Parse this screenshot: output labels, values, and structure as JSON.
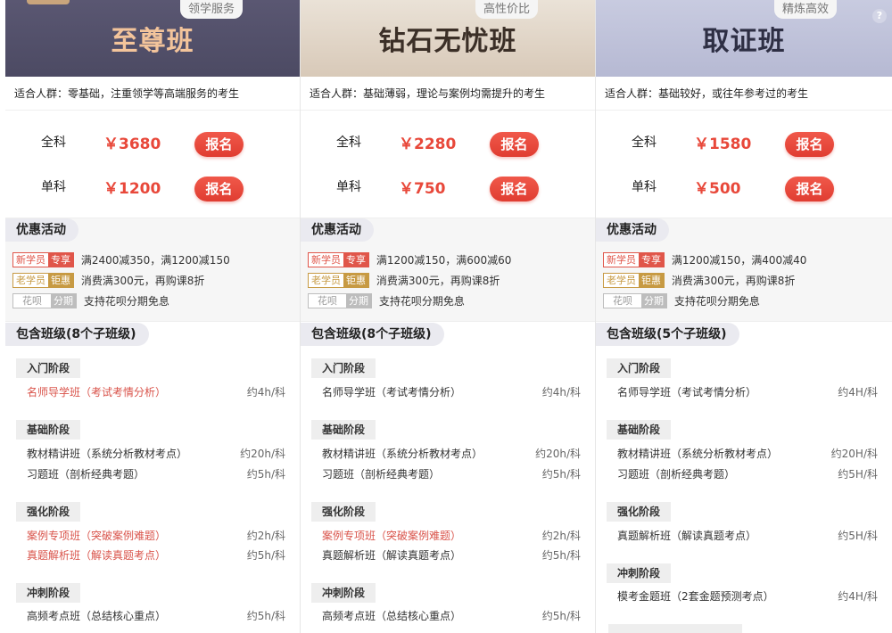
{
  "columns": [
    {
      "title": "至尊班",
      "tag": "领学服务",
      "audience": "适合人群：零基础，注重领学等高端服务的考生",
      "prices": [
        {
          "label": "全科",
          "price": "￥3680",
          "button": "报名"
        },
        {
          "label": "单科",
          "price": "￥1200",
          "button": "报名"
        }
      ],
      "promo_title": "优惠活动",
      "promos": [
        {
          "badge1": "新学员",
          "badge2": "专享",
          "text": "满2400减350，满1200减150"
        },
        {
          "badge1": "老学员",
          "badge2": "钜惠",
          "text": "消费满300元，再购课8折"
        },
        {
          "badge1": "花呗",
          "badge2": "分期",
          "text": "支持花呗分期免息"
        }
      ],
      "package_title": "包含班级(8个子班级)",
      "stages": [
        {
          "name": "入门阶段",
          "courses": [
            {
              "name": "名师导学班（考试考情分析）",
              "duration": "约4h/科",
              "highlight": true
            }
          ]
        },
        {
          "name": "基础阶段",
          "courses": [
            {
              "name": "教材精讲班（系统分析教材考点）",
              "duration": "约20h/科",
              "highlight": false
            },
            {
              "name": "习题班（剖析经典考题）",
              "duration": "约5h/科",
              "highlight": false
            }
          ]
        },
        {
          "name": "强化阶段",
          "courses": [
            {
              "name": "案例专项班（突破案例难题）",
              "duration": "约2h/科",
              "highlight": true
            },
            {
              "name": "真题解析班（解读真题考点）",
              "duration": "约5h/科",
              "highlight": true
            }
          ]
        },
        {
          "name": "冲刺阶段",
          "courses": [
            {
              "name": "高频考点班（总结核心重点）",
              "duration": "约5h/科",
              "highlight": false
            }
          ]
        }
      ]
    },
    {
      "title": "钻石无忧班",
      "tag": "高性价比",
      "audience": "适合人群：基础薄弱，理论与案例均需提升的考生",
      "prices": [
        {
          "label": "全科",
          "price": "￥2280",
          "button": "报名"
        },
        {
          "label": "单科",
          "price": "￥750",
          "button": "报名"
        }
      ],
      "promo_title": "优惠活动",
      "promos": [
        {
          "badge1": "新学员",
          "badge2": "专享",
          "text": "满1200减150，满600减60"
        },
        {
          "badge1": "老学员",
          "badge2": "钜惠",
          "text": "消费满300元，再购课8折"
        },
        {
          "badge1": "花呗",
          "badge2": "分期",
          "text": "支持花呗分期免息"
        }
      ],
      "package_title": "包含班级(8个子班级)",
      "stages": [
        {
          "name": "入门阶段",
          "courses": [
            {
              "name": "名师导学班（考试考情分析）",
              "duration": "约4h/科",
              "highlight": false
            }
          ]
        },
        {
          "name": "基础阶段",
          "courses": [
            {
              "name": "教材精讲班（系统分析教材考点）",
              "duration": "约20h/科",
              "highlight": false
            },
            {
              "name": "习题班（剖析经典考题）",
              "duration": "约5h/科",
              "highlight": false
            }
          ]
        },
        {
          "name": "强化阶段",
          "courses": [
            {
              "name": "案例专项班（突破案例难题）",
              "duration": "约2h/科",
              "highlight": true
            },
            {
              "name": "真题解析班（解读真题考点）",
              "duration": "约5h/科",
              "highlight": false
            }
          ]
        },
        {
          "name": "冲刺阶段",
          "courses": [
            {
              "name": "高频考点班（总结核心重点）",
              "duration": "约5h/科",
              "highlight": false
            }
          ]
        }
      ]
    },
    {
      "title": "取证班",
      "tag": "精炼高效",
      "audience": "适合人群：基础较好，或往年参考过的考生",
      "prices": [
        {
          "label": "全科",
          "price": "￥1580",
          "button": "报名"
        },
        {
          "label": "单科",
          "price": "￥500",
          "button": "报名"
        }
      ],
      "promo_title": "优惠活动",
      "promos": [
        {
          "badge1": "新学员",
          "badge2": "专享",
          "text": "满1200减150，满400减40"
        },
        {
          "badge1": "老学员",
          "badge2": "钜惠",
          "text": "消费满300元，再购课8折"
        },
        {
          "badge1": "花呗",
          "badge2": "分期",
          "text": "支持花呗分期免息"
        }
      ],
      "package_title": "包含班级(5个子班级)",
      "stages": [
        {
          "name": "入门阶段",
          "courses": [
            {
              "name": "名师导学班（考试考情分析）",
              "duration": "约4H/科",
              "highlight": false
            }
          ]
        },
        {
          "name": "基础阶段",
          "courses": [
            {
              "name": "教材精讲班（系统分析教材考点）",
              "duration": "约20H/科",
              "highlight": false
            },
            {
              "name": "习题班（剖析经典考题）",
              "duration": "约5H/科",
              "highlight": false
            }
          ]
        },
        {
          "name": "强化阶段",
          "courses": [
            {
              "name": "真题解析班（解读真题考点）",
              "duration": "约5H/科",
              "highlight": false
            }
          ]
        },
        {
          "name": "冲刺阶段",
          "courses": [
            {
              "name": "模考金题班（2套金题预测考点）",
              "duration": "约4H/科",
              "highlight": false
            }
          ]
        }
      ]
    }
  ],
  "help_icon": "question-mark-icon",
  "colors": {
    "price_red": "#e8483a",
    "button_red": "#e03d31",
    "highlight_red": "#d9534a",
    "badge_gold": "#c79a43"
  }
}
